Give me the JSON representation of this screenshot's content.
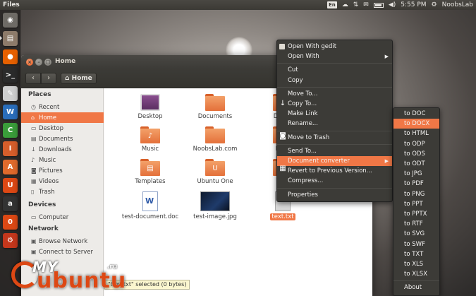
{
  "top_panel": {
    "app_title": "Files",
    "keyboard_layout": "En",
    "time": "5:55 PM",
    "user": "NoobsLab",
    "icons": [
      "keyboard-icon",
      "cloud-icon",
      "network-icon",
      "mail-icon",
      "battery-icon",
      "volume-icon",
      "gear-icon"
    ]
  },
  "launcher": {
    "items": [
      {
        "name": "dash-home",
        "glyph": "◉",
        "color": "#6e6b66"
      },
      {
        "name": "files",
        "glyph": "▤",
        "color": "#8d7b6a"
      },
      {
        "name": "firefox",
        "glyph": "●",
        "color": "#e66000"
      },
      {
        "name": "terminal",
        "glyph": ">_",
        "color": "#2b2b2b"
      },
      {
        "name": "text-editor",
        "glyph": "✎",
        "color": "#cfcfcf"
      },
      {
        "name": "writer",
        "glyph": "W",
        "color": "#2a6ebb"
      },
      {
        "name": "calc",
        "glyph": "C",
        "color": "#3a9d3a"
      },
      {
        "name": "impress",
        "glyph": "I",
        "color": "#d65e2b"
      },
      {
        "name": "software-center",
        "glyph": "A",
        "color": "#e06a2c"
      },
      {
        "name": "ubuntu-one",
        "glyph": "U",
        "color": "#dd4814"
      },
      {
        "name": "amazon",
        "glyph": "a",
        "color": "#333333"
      },
      {
        "name": "ubuntu-one-music",
        "glyph": "0",
        "color": "#dd4814"
      },
      {
        "name": "system-settings",
        "glyph": "⚙",
        "color": "#c4371c"
      }
    ]
  },
  "window": {
    "title": "Home",
    "back": "‹",
    "forward": "›",
    "path_button": "Home"
  },
  "sidebar": {
    "places_heading": "Places",
    "places": [
      {
        "label": "Recent",
        "icon": "◷",
        "icon_name": "clock-icon"
      },
      {
        "label": "Home",
        "icon": "⌂",
        "icon_name": "home-icon",
        "selected": true
      },
      {
        "label": "Desktop",
        "icon": "▭",
        "icon_name": "desktop-icon"
      },
      {
        "label": "Documents",
        "icon": "▤",
        "icon_name": "documents-icon"
      },
      {
        "label": "Downloads",
        "icon": "↓",
        "icon_name": "download-icon"
      },
      {
        "label": "Music",
        "icon": "♪",
        "icon_name": "music-icon"
      },
      {
        "label": "Pictures",
        "icon": "◙",
        "icon_name": "camera-icon"
      },
      {
        "label": "Videos",
        "icon": "▦",
        "icon_name": "film-icon"
      },
      {
        "label": "Trash",
        "icon": "▯",
        "icon_name": "trash-icon"
      }
    ],
    "devices_heading": "Devices",
    "devices": [
      {
        "label": "Computer",
        "icon": "▭",
        "icon_name": "computer-icon"
      }
    ],
    "network_heading": "Network",
    "network": [
      {
        "label": "Browse Network",
        "icon": "▣",
        "icon_name": "network-icon"
      },
      {
        "label": "Connect to Server",
        "icon": "▣",
        "icon_name": "server-icon"
      }
    ]
  },
  "files": [
    {
      "label": "Desktop",
      "kind": "desktop"
    },
    {
      "label": "Documents",
      "kind": "folder",
      "glyph": ""
    },
    {
      "label": "Downl",
      "kind": "folder",
      "glyph": "↓"
    },
    {
      "label": "Music",
      "kind": "folder",
      "glyph": "♪"
    },
    {
      "label": "NoobsLab.com",
      "kind": "folder",
      "glyph": ""
    },
    {
      "label": "Pictu",
      "kind": "folder",
      "glyph": "◙"
    },
    {
      "label": "Templates",
      "kind": "folder",
      "glyph": "▤"
    },
    {
      "label": "Ubuntu One",
      "kind": "folder",
      "glyph": "U"
    },
    {
      "label": "Vide",
      "kind": "folder",
      "glyph": "▦"
    },
    {
      "label": "test-document.doc",
      "kind": "doc"
    },
    {
      "label": "test-image.jpg",
      "kind": "image"
    },
    {
      "label": "text.txt",
      "kind": "txt",
      "selected": true
    }
  ],
  "status_bar": "\"text.txt\" selected  (0 bytes)",
  "context_menu": {
    "items": [
      {
        "label": "Open With gedit",
        "check": true
      },
      {
        "label": "Open With",
        "submenu": true
      },
      {
        "sep": true
      },
      {
        "label": "Cut"
      },
      {
        "label": "Copy"
      },
      {
        "sep": true
      },
      {
        "label": "Move To..."
      },
      {
        "label": "Copy To..."
      },
      {
        "label": "Make Link"
      },
      {
        "label": "Rename..."
      },
      {
        "sep": true
      },
      {
        "label": "Move to Trash"
      },
      {
        "sep": true
      },
      {
        "label": "Send To..."
      },
      {
        "label": "Document converter",
        "submenu": true,
        "highlight": true
      },
      {
        "label": "Revert to Previous Version..."
      },
      {
        "label": "Compress..."
      },
      {
        "sep": true
      },
      {
        "label": "Properties"
      }
    ]
  },
  "converter_menu": {
    "items": [
      {
        "label": "to DOC"
      },
      {
        "label": "to DOCX",
        "highlight": true
      },
      {
        "label": "to HTML"
      },
      {
        "label": "to ODP"
      },
      {
        "label": "to ODS"
      },
      {
        "label": "to ODT"
      },
      {
        "label": "to JPG"
      },
      {
        "label": "to PDF"
      },
      {
        "label": "to PNG"
      },
      {
        "label": "to PPT"
      },
      {
        "label": "to PPTX"
      },
      {
        "label": "to RTF"
      },
      {
        "label": "to SVG"
      },
      {
        "label": "to SWF"
      },
      {
        "label": "to TXT"
      },
      {
        "label": "to XLS"
      },
      {
        "label": "to XLSX"
      },
      {
        "sep": true
      },
      {
        "label": "About"
      }
    ]
  },
  "watermark": {
    "my": "MY",
    "ubuntu": "ubuntu",
    "tld": ".ru"
  }
}
